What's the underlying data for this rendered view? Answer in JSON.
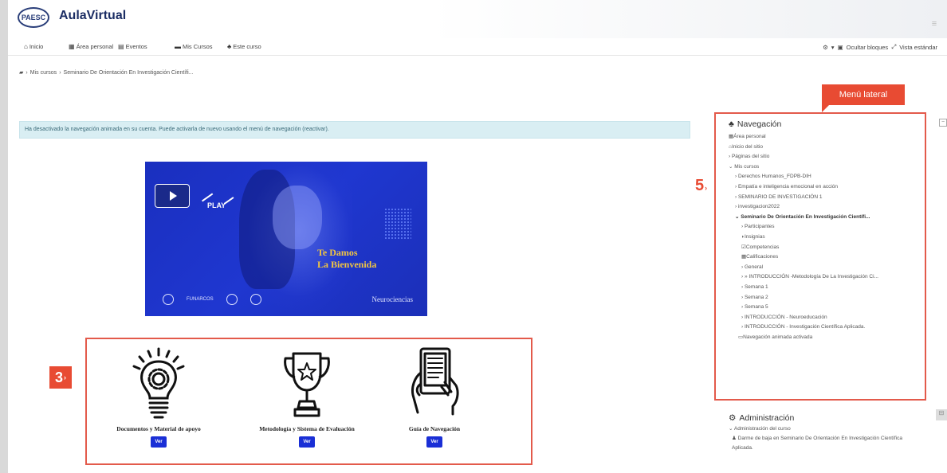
{
  "header": {
    "logo_text": "PAESC",
    "site_title": "AulaVirtual",
    "right_button": "≡"
  },
  "topnav": {
    "items": [
      {
        "label": "Inicio",
        "icon": "home-icon"
      },
      {
        "label": "Área personal",
        "icon": "dashboard-icon"
      },
      {
        "label": "Eventos",
        "icon": "calendar-icon"
      },
      {
        "label": "Mis Cursos",
        "icon": "courses-icon"
      },
      {
        "label": "Este curso",
        "icon": "sitemap-icon"
      }
    ],
    "right": {
      "gear_caret": "▾",
      "hide_blocks": "Ocultar bloques",
      "standard_view": "Vista estándar"
    }
  },
  "breadcrumb": [
    "Mis cursos",
    "Seminario De Orientación En Investigación Científi..."
  ],
  "notice": "Ha desactivado la navegación animada en su cuenta. Puede activarla de nuevo usando el menú de navegación (reactivar).",
  "video": {
    "play_word": "PLAY",
    "welcome_line1": "Te Damos",
    "welcome_line2": "La Bienvenida",
    "partner_1": "FUNARCOS",
    "brand": "Neurociencias"
  },
  "resources": [
    {
      "label": "Documentos y Material de apoyo",
      "button": "Ver",
      "icon": "lightbulb-gear-icon"
    },
    {
      "label": "Metodología y Sistema de  Evaluación",
      "button": "Ver",
      "icon": "trophy-icon"
    },
    {
      "label": "Guía de Navegación",
      "button": "Ver",
      "icon": "tablet-hand-icon"
    }
  ],
  "callouts": {
    "three": "3",
    "five": "5",
    "menu_tag": "Menú lateral"
  },
  "navigation": {
    "title": "Navegación",
    "items": [
      "Área personal",
      "Inicio del sitio",
      "›  Páginas del sitio",
      "⌄ Mis cursos",
      "›  Derechos Humanos_FDPB-DIH",
      "›  Empatía e inteligencia emocional en acción",
      "›  SEMINARIO DE INVESTIGACIÓN 1",
      "›  investigacion2022",
      "⌄ Seminario De Orientación En Investigación Científi...",
      "›  Participantes",
      "Insignias",
      "Competencias",
      "Calificaciones",
      "›  General",
      "›  » INTRODUCCIÓN -Metodología De La Investigación Ci...",
      "›  Semana 1",
      "›  Semana 2",
      "›  Semana 5",
      "›  INTRODUCCIÓN - Neuroeducación",
      "›  INTRODUCCIÓN - Investigación Científica Aplicada.",
      "Navegación animada activada"
    ]
  },
  "administration": {
    "title": "Administración",
    "items": [
      "⌄ Administración del curso",
      "Darme de baja en Seminario De Orientación En Investigación Científica",
      "Aplicada."
    ]
  },
  "colors": {
    "accent_red": "#e84b33",
    "button_blue": "#1a2fd6",
    "video_blue": "#1f37d0",
    "notice_bg": "#d9eef3"
  }
}
